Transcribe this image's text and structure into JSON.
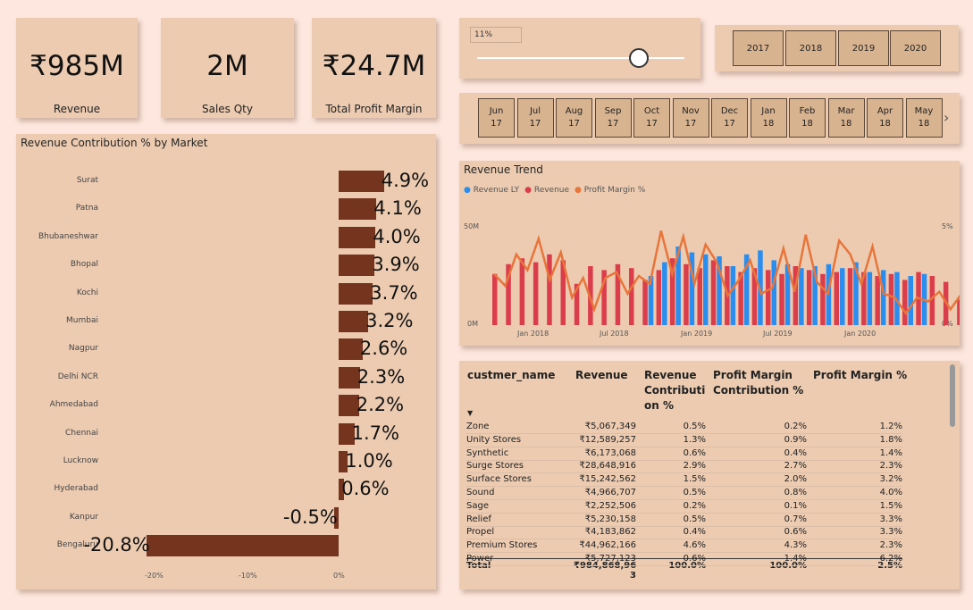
{
  "kpis": [
    {
      "value": "₹985M",
      "label": "Revenue"
    },
    {
      "value": "2M",
      "label": "Sales Qty"
    },
    {
      "value": "₹24.7M",
      "label": "Total Profit Margin"
    }
  ],
  "slider": {
    "value_label": "11%",
    "fraction": 0.78
  },
  "years": [
    "2017",
    "2018",
    "2019",
    "2020"
  ],
  "months": [
    {
      "m": "Jun",
      "y": "17"
    },
    {
      "m": "Jul",
      "y": "17"
    },
    {
      "m": "Aug",
      "y": "17"
    },
    {
      "m": "Sep",
      "y": "17"
    },
    {
      "m": "Oct",
      "y": "17"
    },
    {
      "m": "Nov",
      "y": "17"
    },
    {
      "m": "Dec",
      "y": "17"
    },
    {
      "m": "Jan",
      "y": "18"
    },
    {
      "m": "Feb",
      "y": "18"
    },
    {
      "m": "Mar",
      "y": "18"
    },
    {
      "m": "Apr",
      "y": "18"
    },
    {
      "m": "May",
      "y": "18"
    }
  ],
  "market_chart": {
    "title": "Revenue Contribution % by Market",
    "x_ticks": [
      "-20%",
      "-10%",
      "0%"
    ]
  },
  "trend_chart": {
    "title": "Revenue Trend",
    "legend": [
      {
        "name": "Revenue LY",
        "color": "#2a8ef0"
      },
      {
        "name": "Revenue",
        "color": "#dc3d4b"
      },
      {
        "name": "Profit Margin %",
        "color": "#e8753a"
      }
    ],
    "y_left": [
      "50M",
      "0M"
    ],
    "y_right": [
      "5%",
      "0%"
    ],
    "x_ticks": [
      "Jan 2018",
      "Jul 2018",
      "Jan 2019",
      "Jul 2019",
      "Jan 2020"
    ]
  },
  "chart_data": [
    {
      "type": "bar",
      "title": "Revenue Contribution % by Market",
      "categories": [
        "Surat",
        "Patna",
        "Bhubaneshwar",
        "Bhopal",
        "Kochi",
        "Mumbai",
        "Nagpur",
        "Delhi NCR",
        "Ahmedabad",
        "Chennai",
        "Lucknow",
        "Hyderabad",
        "Kanpur",
        "Bengaluru"
      ],
      "values": [
        4.9,
        4.1,
        4.0,
        3.9,
        3.7,
        3.2,
        2.6,
        2.3,
        2.2,
        1.7,
        1.0,
        0.6,
        -0.5,
        -20.8
      ],
      "value_labels": [
        "4.9%",
        "4.1%",
        "4.0%",
        "3.9%",
        "3.7%",
        "3.2%",
        "2.6%",
        "2.3%",
        "2.2%",
        "1.7%",
        "1.0%",
        "0.6%",
        "-0.5%",
        "-20.8%"
      ],
      "xlim": [
        -22,
        5.5
      ],
      "orientation": "horizontal"
    },
    {
      "type": "bar",
      "title": "Revenue Trend",
      "x_ticks": [
        "Jan 2018",
        "Jul 2018",
        "Jan 2019",
        "Jul 2019",
        "Jan 2020"
      ],
      "series": [
        {
          "name": "Revenue",
          "values": [
            26,
            31,
            34,
            32,
            36,
            33,
            21,
            30,
            28,
            31,
            29,
            23,
            28,
            34,
            31,
            29,
            33,
            30,
            27,
            29,
            28,
            26,
            30,
            28,
            26,
            27,
            29,
            27,
            25,
            26,
            23,
            27,
            25,
            22,
            13
          ]
        },
        {
          "name": "Revenue LY",
          "values": [
            0,
            0,
            0,
            0,
            0,
            0,
            0,
            0,
            0,
            0,
            0,
            25,
            32,
            40,
            37,
            36,
            35,
            30,
            36,
            38,
            33,
            31,
            29,
            30,
            31,
            29,
            32,
            27,
            28,
            27,
            25,
            26
          ]
        },
        {
          "name": "Profit Margin %",
          "values": [
            2.6,
            2.0,
            3.6,
            2.8,
            4.4,
            2.3,
            3.7,
            1.4,
            2.4,
            0.8,
            2.4,
            2.7,
            1.6,
            2.5,
            2.1,
            4.8,
            2.6,
            4.5,
            2.1,
            4.1,
            3.2,
            1.5,
            2.3,
            3.3,
            1.6,
            1.9,
            3.9,
            1.7,
            4.6,
            2.2,
            1.6,
            4.3,
            3.6,
            2.1,
            4.0,
            1.6,
            1.4,
            0.6,
            1.4,
            1.2,
            1.7,
            0.8,
            1.6
          ]
        }
      ],
      "y_left_ticks": [
        "50M",
        "0M"
      ],
      "y_right_ticks": [
        "5%",
        "0%"
      ]
    }
  ],
  "table": {
    "headers": [
      "custmer_name",
      "Revenue",
      "Revenue Contributi on %",
      "Profit Margin Contribution %",
      "Profit Margin %"
    ],
    "rows": [
      [
        "Zone",
        "₹5,067,349",
        "0.5%",
        "0.2%",
        "1.2%"
      ],
      [
        "Unity Stores",
        "₹12,589,257",
        "1.3%",
        "0.9%",
        "1.8%"
      ],
      [
        "Synthetic",
        "₹6,173,068",
        "0.6%",
        "0.4%",
        "1.4%"
      ],
      [
        "Surge Stores",
        "₹28,648,916",
        "2.9%",
        "2.7%",
        "2.3%"
      ],
      [
        "Surface Stores",
        "₹15,242,562",
        "1.5%",
        "2.0%",
        "3.2%"
      ],
      [
        "Sound",
        "₹4,966,707",
        "0.5%",
        "0.8%",
        "4.0%"
      ],
      [
        "Sage",
        "₹2,252,506",
        "0.2%",
        "0.1%",
        "1.5%"
      ],
      [
        "Relief",
        "₹5,230,158",
        "0.5%",
        "0.7%",
        "3.3%"
      ],
      [
        "Propel",
        "₹4,183,862",
        "0.4%",
        "0.6%",
        "3.3%"
      ],
      [
        "Premium Stores",
        "₹44,962,166",
        "4.6%",
        "4.3%",
        "2.3%"
      ],
      [
        "Power",
        "₹5,727,123",
        "0.6%",
        "1.4%",
        "6.2%"
      ]
    ],
    "total": [
      "Total",
      "₹984,868,96 3",
      "100.0%",
      "100.0%",
      "2.5%"
    ]
  }
}
